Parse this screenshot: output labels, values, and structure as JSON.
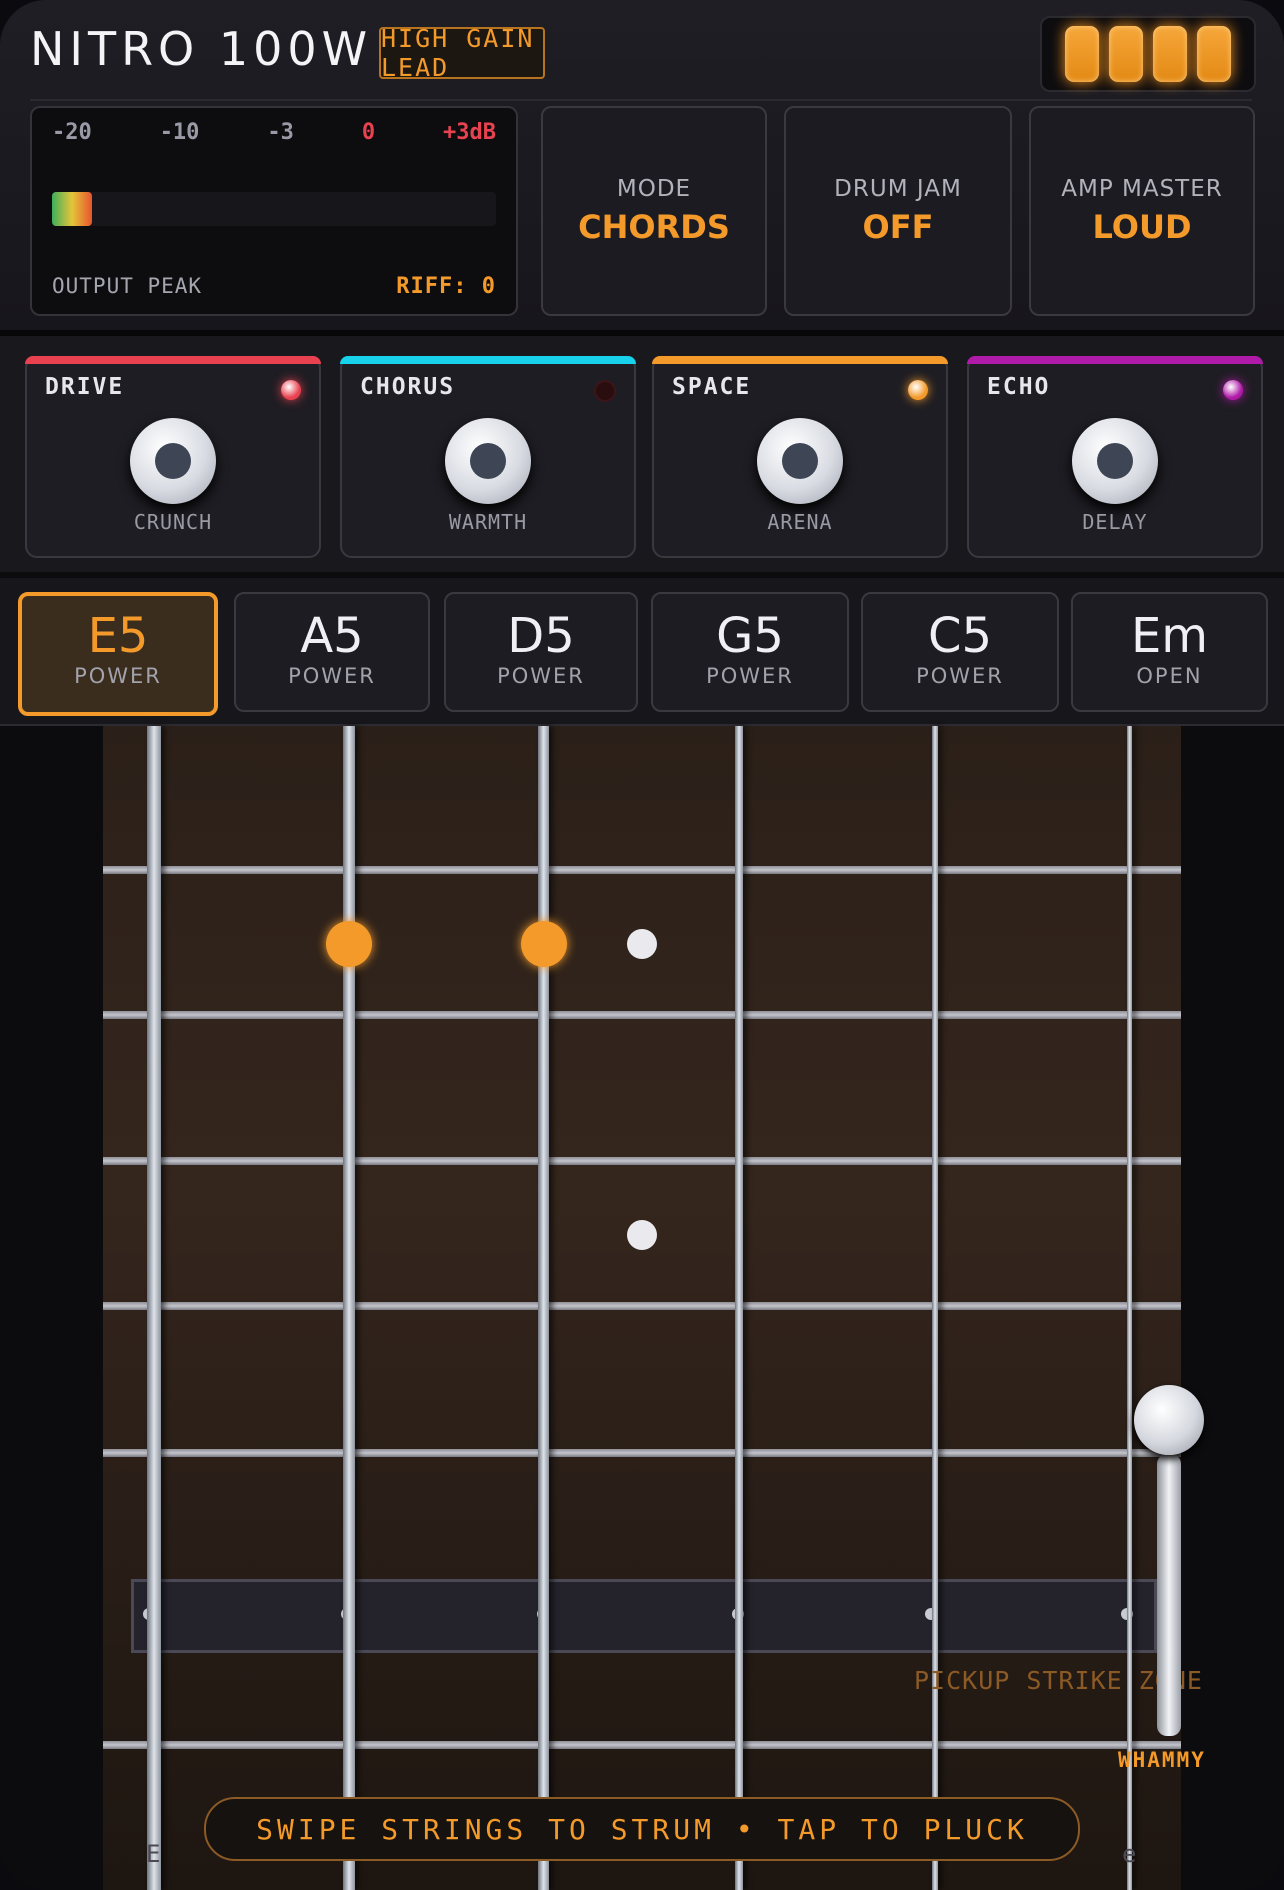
{
  "header": {
    "title": "NITRO 100W",
    "preset": "HIGH GAIN LEAD",
    "tube_count": 4
  },
  "meter": {
    "ticks": [
      "-20",
      "-10",
      "-3",
      "0",
      "+3dB"
    ],
    "level": 0.09,
    "label": "OUTPUT PEAK",
    "riff": "RIFF: 0"
  },
  "switches": [
    {
      "label": "MODE",
      "value": "CHORDS"
    },
    {
      "label": "DRUM JAM",
      "value": "OFF"
    },
    {
      "label": "AMP MASTER",
      "value": "LOUD"
    }
  ],
  "effects": [
    {
      "name": "DRIVE",
      "knob": "CRUNCH",
      "color": "#e8414f",
      "led_on": true
    },
    {
      "name": "CHORUS",
      "knob": "WARMTH",
      "color": "#18d2ec",
      "led_on": false
    },
    {
      "name": "SPACE",
      "knob": "ARENA",
      "color": "#f39a2b",
      "led_on": true
    },
    {
      "name": "ECHO",
      "knob": "DELAY",
      "color": "#b01aa8",
      "led_on": true
    }
  ],
  "chords": [
    {
      "chord": "E5",
      "type": "POWER",
      "selected": true
    },
    {
      "chord": "A5",
      "type": "POWER",
      "selected": false
    },
    {
      "chord": "D5",
      "type": "POWER",
      "selected": false
    },
    {
      "chord": "G5",
      "type": "POWER",
      "selected": false
    },
    {
      "chord": "C5",
      "type": "POWER",
      "selected": false
    },
    {
      "chord": "Em",
      "type": "OPEN",
      "selected": false
    }
  ],
  "fretboard": {
    "pickup_label": "PICKUP STRIKE ZONE",
    "whammy_label": "WHAMMY",
    "hint": "SWIPE STRINGS TO STRUM • TAP TO PLUCK",
    "string_names": [
      "E",
      "e"
    ]
  },
  "colors": {
    "accent": "#f39a2b",
    "background": "#111116"
  }
}
